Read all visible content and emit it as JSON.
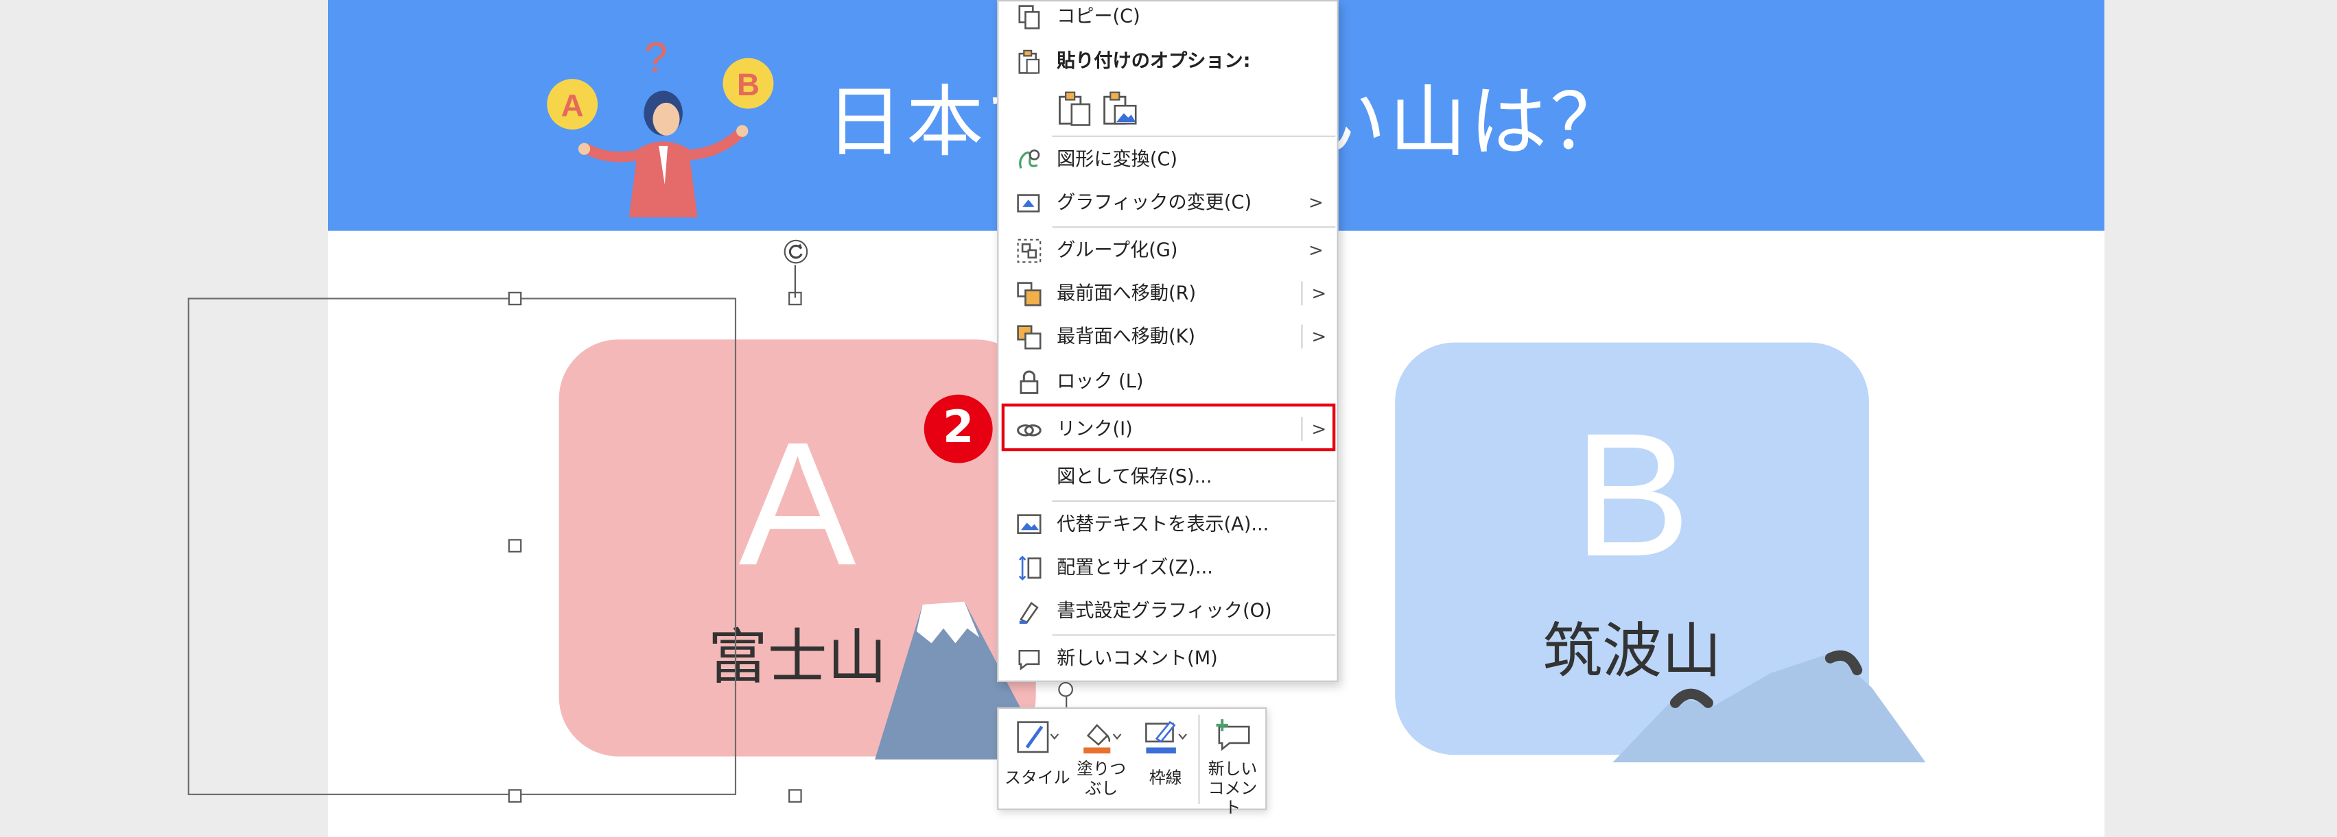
{
  "slide": {
    "title": "日本で一番高い山は？",
    "illustration": {
      "bubble_a": "A",
      "bubble_b": "B",
      "question_mark": "?"
    },
    "option_a": {
      "letter": "A",
      "name": "富士山"
    },
    "option_b": {
      "letter": "B",
      "name": "筑波山"
    }
  },
  "context_menu": {
    "items": [
      {
        "label": "コピー(C)",
        "icon": "copy-icon"
      },
      {
        "label": "貼り付けのオプション:",
        "icon": "paste-icon"
      },
      {
        "label": "図形に変換(C)",
        "icon": "convert-shape-icon"
      },
      {
        "label": "グラフィックの変更(C)",
        "icon": "change-graphic-icon",
        "submenu": true
      },
      {
        "label": "グループ化(G)",
        "icon": "group-icon",
        "submenu": true
      },
      {
        "label": "最前面へ移動(R)",
        "icon": "bring-front-icon",
        "submenu": true
      },
      {
        "label": "最背面へ移動(K)",
        "icon": "send-back-icon",
        "submenu": true
      },
      {
        "label": "ロック (L)",
        "icon": "lock-icon"
      },
      {
        "label": "リンク(I)",
        "icon": "link-icon",
        "submenu": true,
        "highlighted": true
      },
      {
        "label": "図として保存(S)...",
        "icon": ""
      },
      {
        "label": "代替テキストを表示(A)...",
        "icon": "alt-text-icon"
      },
      {
        "label": "配置とサイズ(Z)...",
        "icon": "size-position-icon"
      },
      {
        "label": "書式設定グラフィック(O)",
        "icon": "format-graphic-icon"
      },
      {
        "label": "新しいコメント(M)",
        "icon": "new-comment-icon"
      }
    ],
    "submenu_arrow": ">"
  },
  "step_badge": "2",
  "mini_toolbar": {
    "style_label": "スタイル",
    "fill_label": "塗りつ\nぶし",
    "outline_label": "枠線",
    "comment_label": "新しい\nコメント"
  },
  "colors": {
    "header_blue": "#5597f5",
    "card_a_pink": "#f5b8b8",
    "card_b_blue": "#bcd6f9",
    "highlight_red": "#e60012",
    "fill_orange": "#e8712e",
    "outline_blue": "#3b6fd8"
  }
}
